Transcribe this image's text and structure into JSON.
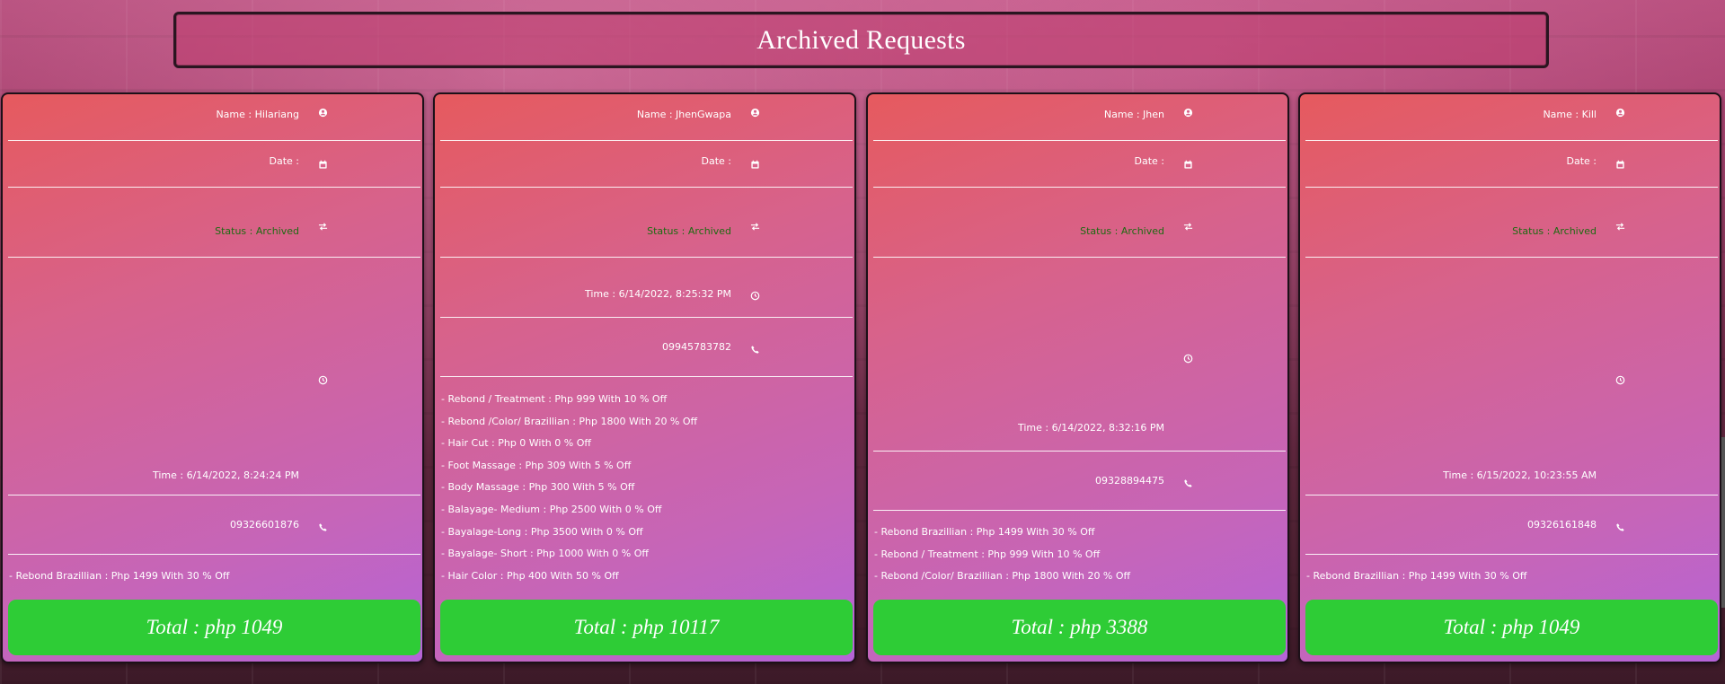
{
  "page": {
    "title": "Archived Requests"
  },
  "cards": [
    {
      "name": "Name : Hilariang",
      "date": "Date :",
      "status": "Status : Archived",
      "time": "Time : 6/14/2022, 8:24:24 PM",
      "phone": "09326601876",
      "services": [
        "- Rebond Brazillian : Php 1499 With 30 % Off"
      ],
      "total": "Total : php 1049"
    },
    {
      "name": "Name : JhenGwapa",
      "date": "Date :",
      "status": "Status : Archived",
      "time": "Time : 6/14/2022, 8:25:32 PM",
      "phone": "09945783782",
      "services": [
        "- Rebond / Treatment : Php 999 With 10 % Off",
        "- Rebond /Color/ Brazillian : Php 1800 With 20 % Off",
        "- Hair Cut : Php 0 With 0 % Off",
        "- Foot Massage : Php 309 With 5 % Off",
        "- Body Massage : Php 300 With 5 % Off",
        "- Balayage- Medium : Php 2500 With 0 % Off",
        "- Bayalage-Long : Php 3500 With 0 % Off",
        "- Bayalage- Short : Php 1000 With 0 % Off",
        "- Hair Color : Php 400 With 50 % Off"
      ],
      "total": "Total : php 10117"
    },
    {
      "name": "Name : Jhen",
      "date": "Date :",
      "status": "Status : Archived",
      "time": "Time : 6/14/2022, 8:32:16 PM",
      "phone": "09328894475",
      "services": [
        "- Rebond Brazillian : Php 1499 With 30 % Off",
        "- Rebond / Treatment : Php 999 With 10 % Off",
        "- Rebond /Color/ Brazillian : Php 1800 With 20 % Off"
      ],
      "total": "Total : php 3388"
    },
    {
      "name": "Name : Kill",
      "date": "Date :",
      "status": "Status : Archived",
      "time": "Time : 6/15/2022, 10:23:55 AM",
      "phone": "09326161848",
      "services": [
        "- Rebond Brazillian : Php 1499 With 30 % Off"
      ],
      "total": "Total : php 1049"
    }
  ],
  "colors": {
    "archived_status": "#1d6b12",
    "total_button": "#2ecc36"
  },
  "icons": {
    "name": "account-circle-icon",
    "date": "calendar-icon",
    "status": "swap-arrows-icon",
    "time": "clock-icon",
    "phone": "phone-icon"
  }
}
